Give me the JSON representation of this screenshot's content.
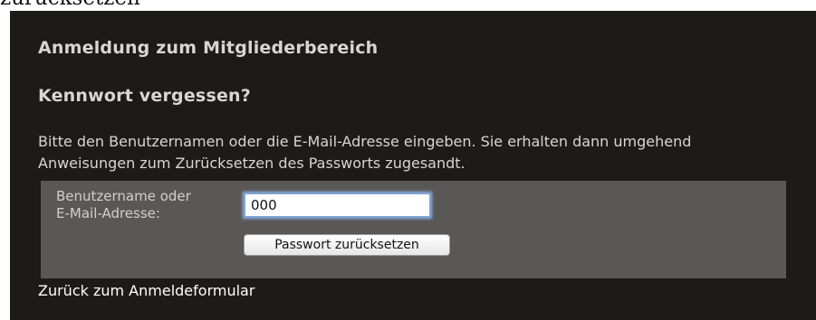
{
  "page": {
    "partial_title": "zurücksetzen"
  },
  "login_panel": {
    "heading": "Anmeldung zum Mitgliederbereich",
    "subheading": "Kennwort vergessen?",
    "intro": "Bitte den Benutzernamen oder die E-Mail-Adresse eingeben. Sie erhalten dann umgehend Anweisungen zum Zurücksetzen des Passworts zugesandt.",
    "form": {
      "label_line1": "Benutzername oder",
      "label_line2": "E-Mail-Adresse:",
      "input_value": "000",
      "submit_label": "Passwort zurücksetzen"
    },
    "back_link": "Zurück zum Anmeldeformular"
  },
  "colors": {
    "panel_background": "#1d1b1a",
    "form_background": "#5a5857",
    "heading_text": "#d6d6d6",
    "link_text": "#ffffff",
    "input_focus_glow": "#89b3ea"
  }
}
